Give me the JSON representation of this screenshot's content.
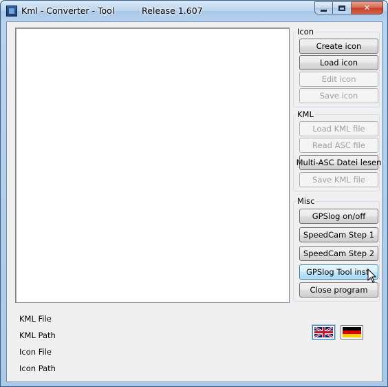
{
  "window": {
    "title": "Kml - Converter - Tool",
    "release": "Release 1.607",
    "minimize_icon": "minimize-icon",
    "maximize_icon": "maximize-icon",
    "close_icon": "close-icon",
    "close_glyph": "✕"
  },
  "groups": {
    "icon": {
      "label": "Icon",
      "buttons": [
        {
          "label": "Create icon",
          "enabled": true
        },
        {
          "label": "Load icon",
          "enabled": true
        },
        {
          "label": "Edit icon",
          "enabled": false
        },
        {
          "label": "Save icon",
          "enabled": false
        }
      ]
    },
    "kml": {
      "label": "KML",
      "buttons": [
        {
          "label": "Load KML file",
          "enabled": false
        },
        {
          "label": "Read ASC file",
          "enabled": false
        },
        {
          "label": "Multi-ASC Datei lesen",
          "enabled": true
        },
        {
          "label": "Save KML file",
          "enabled": false
        }
      ]
    },
    "misc": {
      "label": "Misc",
      "buttons": [
        {
          "label": "GPSlog on/off",
          "enabled": true
        },
        {
          "label": "SpeedCam Step 1",
          "enabled": true
        },
        {
          "label": "SpeedCam Step 2",
          "enabled": true
        },
        {
          "label": "GPSlog  Tool  inst.",
          "enabled": true,
          "hover": true
        },
        {
          "label": "Close program",
          "enabled": true
        }
      ]
    }
  },
  "info": {
    "kml_file": "KML File",
    "kml_path": "KML Path",
    "icon_file": "Icon File",
    "icon_path": "Icon Path"
  },
  "language": {
    "english_icon": "uk-flag-icon",
    "german_icon": "german-flag-icon",
    "selected": "english"
  },
  "colors": {
    "window_face": "#f0f0f0",
    "hover_border": "#3c7fb1",
    "disabled_text": "#a0a0a0"
  }
}
